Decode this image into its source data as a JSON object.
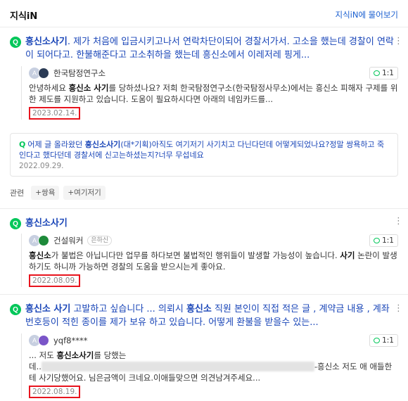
{
  "header": {
    "title": "지식iN",
    "ask_link": "지식iN에 물어보기"
  },
  "q_icon": "Q",
  "items": [
    {
      "question_bold": "흥신소사기",
      "question_rest": ". 제가 처음에 입금시키고나서 연락차단이되어 경찰서가서. 고소을 했는데 경찰이 연락이 되어다고. 한불해준다고 고소취하을 했는데 흥신소에서 이레저레 핑게...",
      "answerer": "한국탐정연구소",
      "answerer_badge": "",
      "oneone": "1:1",
      "answer_parts": [
        "안녕하세요 ",
        "흥신소 사기",
        "를 당하셨나요? 저희 한국탐정연구소(한국탐정사무소)에서는 흥신소 피해자 구제를 위한 제도를 지원하고 있습니다. 도움이 필요하시다면 아래의 네임카드를..."
      ],
      "date": "2023.02.14."
    },
    {
      "question_bold": "흥신소사기",
      "question_rest": "",
      "answerer": "건설워커",
      "answerer_badge": "은하신",
      "oneone": "1:1",
      "answer_parts": [
        "흥신소",
        "가 불법은 아닙니다만 업무를 하다보면 불법적인 행위들이 발생할 가능성이 높습니다. ",
        "사기",
        " 논란이 발생하기도 하니까 가능하면 경찰의 도움을 받으시는게 좋아요."
      ],
      "date": "2022.08.09."
    },
    {
      "question_parts": [
        "흥신소 사기",
        " 고발하고 싶습니다 ... 의뢰시 ",
        "흥신소",
        " 직원 본인이 직접 적은 글 , 계약금 내용 , 계좌번호등이 적힌 종이를 제가 보유 하고 있습니다. 어떻게 환불을 받을수 있는..."
      ],
      "answerer": "yqf8****",
      "answerer_badge": "",
      "oneone": "1:1",
      "answer_prefix": "... 저도 ",
      "answer_bold": "흥신소사기",
      "answer_mid": "를 당했는데..",
      "answer_suffix": "-흥신소 저도 애 애들한테 사기당했어요. 님은금액이 크네요.이애들맞으면 의견남겨주세요...",
      "date": "2022.08.19."
    }
  ],
  "related": {
    "q": "Q",
    "parts": [
      "어제 글 올라왔던 ",
      "흥신소사기",
      "(대*기획)아직도 여기저기 사기치고 다닌다던데 어떻게되었나요?정말 쌍욕하고 죽인다고 했다던데 경찰서에 신고는하셨는지?너무 무섭네요"
    ],
    "date": "2022.09.29."
  },
  "tags": {
    "label": "관련",
    "items": [
      "+쌍욕",
      "+여기저기"
    ]
  },
  "colors": {
    "link": "#1a46b8",
    "green": "#03c75a",
    "highlight_box": "#e8141e"
  }
}
